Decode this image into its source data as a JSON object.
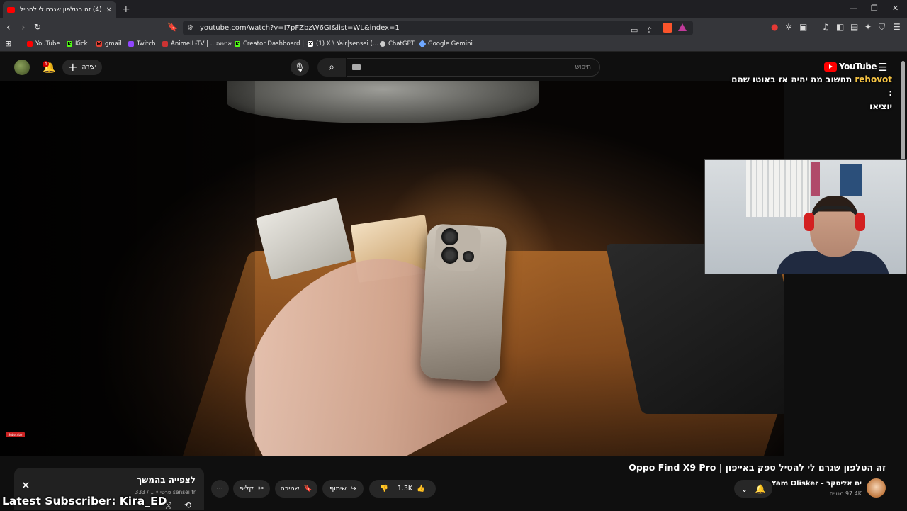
{
  "browser": {
    "tab_title": "(4) זה הטלפון שגרם לי להטיל ספ",
    "url": "youtube.com/watch?v=I7pFZbzW6GI&list=WL&index=1",
    "bookmarks": [
      "YouTube",
      "Kick",
      "gmail",
      "Twitch",
      "AnimeIL-TV | ...אנימה",
      "Creator Dashboard |...",
      "(1) X \\ Yair|sensei (...",
      "ChatGPT",
      "Google Gemini"
    ]
  },
  "youtube": {
    "create_label": "יצירה",
    "notification_count": "4",
    "search_placeholder": "חיפוש",
    "logo_text": "YouTube"
  },
  "overlay": {
    "chat_user": "rehovot",
    "chat_message": "תחשוב מה יהיה אז באוטו שהם : ",
    "chat_line2": "יוציאו",
    "latest_subscriber": "Latest Subscriber: Kira_ED",
    "subscribe_badge": "Subscribe"
  },
  "video": {
    "title": "זה הטלפון שגרם לי להטיל ספק באייפון | Oppo Find X9 Pro",
    "channel_name": "ים אליסקר - Yam Olisker",
    "channel_subs": "97.4K מנויים",
    "like_count": "1.3K",
    "share_label": "שיתוף",
    "save_label": "שמירה",
    "clip_label": "קליפ"
  },
  "playlist": {
    "title": "לצפייה בהמשך",
    "meta": "sensei fr פרטי • 1 / 333"
  },
  "colors": {
    "accent": "#ff0000",
    "chat_user": "#f5c343"
  }
}
